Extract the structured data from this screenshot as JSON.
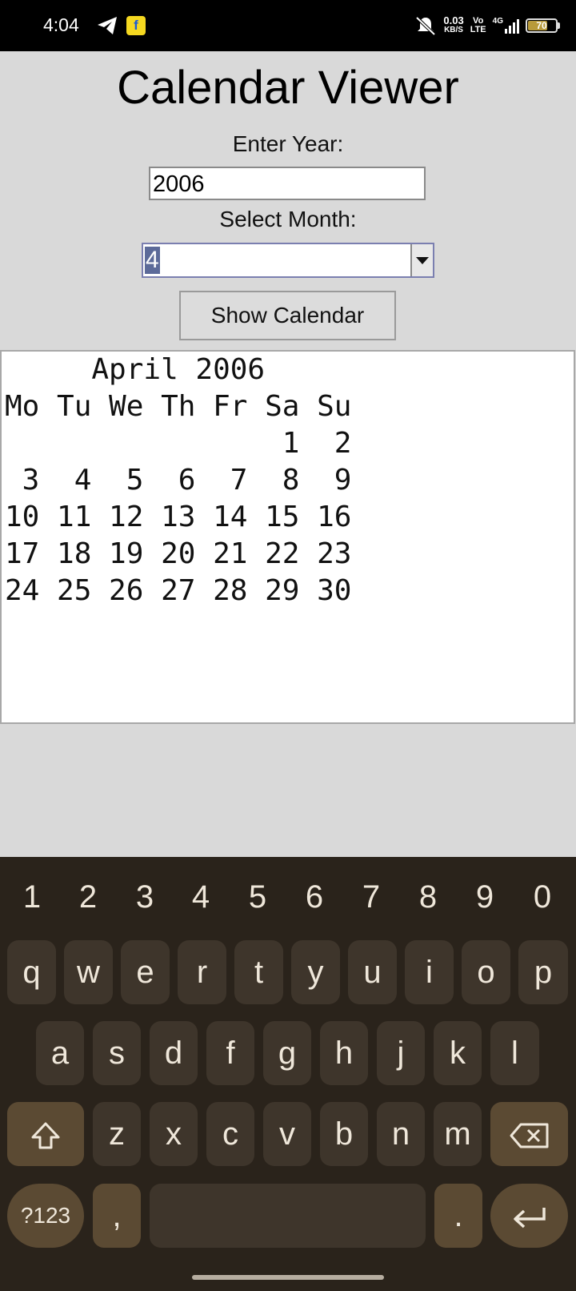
{
  "status_bar": {
    "time": "4:04",
    "net_speed_value": "0.03",
    "net_speed_unit": "KB/S",
    "volte_top": "Vo",
    "volte_bottom": "LTE",
    "network": "4G",
    "battery": "70",
    "battery_level": 0.7,
    "flipkart_glyph": "f"
  },
  "app": {
    "title": "Calendar Viewer",
    "year_label": "Enter Year:",
    "year_value": "2006",
    "month_label": "Select Month:",
    "month_value": "4",
    "show_button": "Show Calendar",
    "calendar": {
      "header": "     April 2006",
      "weekdays": "Mo Tu We Th Fr Sa Su",
      "weeks": [
        "                1  2",
        " 3  4  5  6  7  8  9",
        "10 11 12 13 14 15 16",
        "17 18 19 20 21 22 23",
        "24 25 26 27 28 29 30"
      ]
    }
  },
  "keyboard": {
    "numbers": [
      "1",
      "2",
      "3",
      "4",
      "5",
      "6",
      "7",
      "8",
      "9",
      "0"
    ],
    "row1": [
      "q",
      "w",
      "e",
      "r",
      "t",
      "y",
      "u",
      "i",
      "o",
      "p"
    ],
    "row2": [
      "a",
      "s",
      "d",
      "f",
      "g",
      "h",
      "j",
      "k",
      "l"
    ],
    "row3": [
      "z",
      "x",
      "c",
      "v",
      "b",
      "n",
      "m"
    ],
    "symbols": "?123",
    "comma": ",",
    "period": ".",
    "icons": {
      "shift": "shift-icon",
      "backspace": "backspace-icon",
      "enter": "enter-icon"
    },
    "colors": {
      "background": "#2a231b",
      "key": "#3e352b",
      "special_key": "#5b4a33",
      "text": "#efe7da"
    }
  }
}
